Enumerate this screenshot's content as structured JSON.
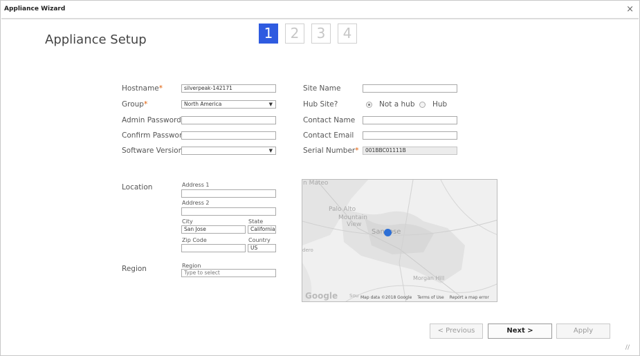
{
  "window": {
    "title": "Appliance Wizard",
    "close_glyph": "×"
  },
  "page": {
    "heading": "Appliance Setup"
  },
  "wizard": {
    "steps": [
      "1",
      "2",
      "3",
      "4"
    ],
    "active_step": "1"
  },
  "form_left": {
    "hostname": {
      "label": "Hostname",
      "required_mark": "*",
      "value": "silverpeak-142171"
    },
    "group": {
      "label": "Group",
      "required_mark": "*",
      "value": "North America"
    },
    "admin_password": {
      "label": "Admin Password",
      "required_mark": "*",
      "value": ""
    },
    "confirm_password": {
      "label": "Confirm Password",
      "required_mark": "*",
      "value": ""
    },
    "software_version": {
      "label": "Software Version",
      "value": ""
    }
  },
  "form_right": {
    "site_name": {
      "label": "Site Name",
      "value": ""
    },
    "hub_site": {
      "label": "Hub Site?",
      "options": [
        "Not a hub",
        "Hub"
      ],
      "selected": "Not a hub"
    },
    "contact_name": {
      "label": "Contact Name",
      "value": ""
    },
    "contact_email": {
      "label": "Contact Email",
      "value": ""
    },
    "serial_number": {
      "label": "Serial Number",
      "required_mark": "*",
      "value": "001BBC01111B"
    }
  },
  "location": {
    "label": "Location",
    "address1": {
      "label": "Address 1",
      "value": ""
    },
    "address2": {
      "label": "Address 2",
      "value": ""
    },
    "city": {
      "label": "City",
      "value": "San Jose"
    },
    "state": {
      "label": "State",
      "value": "California"
    },
    "zip": {
      "label": "Zip Code",
      "value": ""
    },
    "country": {
      "label": "Country",
      "value": "US"
    }
  },
  "region": {
    "label": "Region",
    "field_label": "Region",
    "placeholder": "Type to select"
  },
  "map": {
    "places": [
      "n Mateo",
      "Palo Alto",
      "Mountain",
      "View",
      "San Jose",
      "Morgan Hill",
      "dero",
      "Sou"
    ],
    "logo": "Google",
    "attribution": [
      "Map data ©2018 Google",
      "Terms of Use",
      "Report a map error"
    ]
  },
  "buttons": {
    "previous": "< Previous",
    "next": "Next >",
    "apply": "Apply"
  },
  "icons": {
    "close": "close-icon",
    "caret": "chevron-down-icon",
    "pin": "map-pin-icon",
    "resize": "resize-grip-icon"
  }
}
